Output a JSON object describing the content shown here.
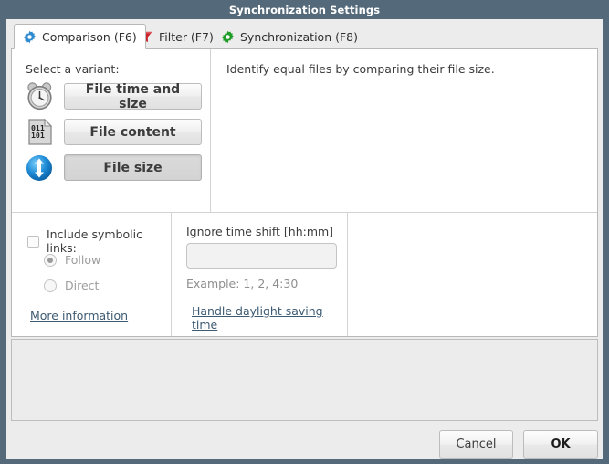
{
  "window": {
    "title": "Synchronization Settings"
  },
  "tabs": [
    {
      "label": "Comparison (F6)",
      "icon": "blue-gear-icon",
      "active": true
    },
    {
      "label": "Filter (F7)",
      "icon": "red-funnel-icon",
      "active": false
    },
    {
      "label": "Synchronization (F8)",
      "icon": "green-gear-icon",
      "active": false
    }
  ],
  "comparison": {
    "variant_label": "Select a variant:",
    "variants": [
      {
        "label": "File time and size",
        "icon": "alarm-clock-icon",
        "selected": false
      },
      {
        "label": "File content",
        "icon": "binary-document-icon",
        "selected": false
      },
      {
        "label": "File size",
        "icon": "blue-updown-arrow-icon",
        "selected": true
      }
    ],
    "description": "Identify equal files by comparing their file size."
  },
  "symbolic_links": {
    "checkbox_label": "Include symbolic links:",
    "checked": false,
    "options": [
      {
        "label": "Follow",
        "selected": true
      },
      {
        "label": "Direct",
        "selected": false
      }
    ],
    "more_information_link": "More information"
  },
  "time_shift": {
    "label": "Ignore time shift [hh:mm]",
    "value": "",
    "placeholder": "",
    "example": "Example:  1, 2, 4:30",
    "dst_link": "Handle daylight saving time"
  },
  "footer": {
    "cancel_label": "Cancel",
    "ok_label": "OK"
  },
  "colors": {
    "titlebar": "#54697a",
    "body": "#ececec",
    "link": "#3c5a72",
    "accent_blue": "#1e8bd6",
    "accent_red": "#c8242a",
    "accent_green": "#1f9b27"
  }
}
